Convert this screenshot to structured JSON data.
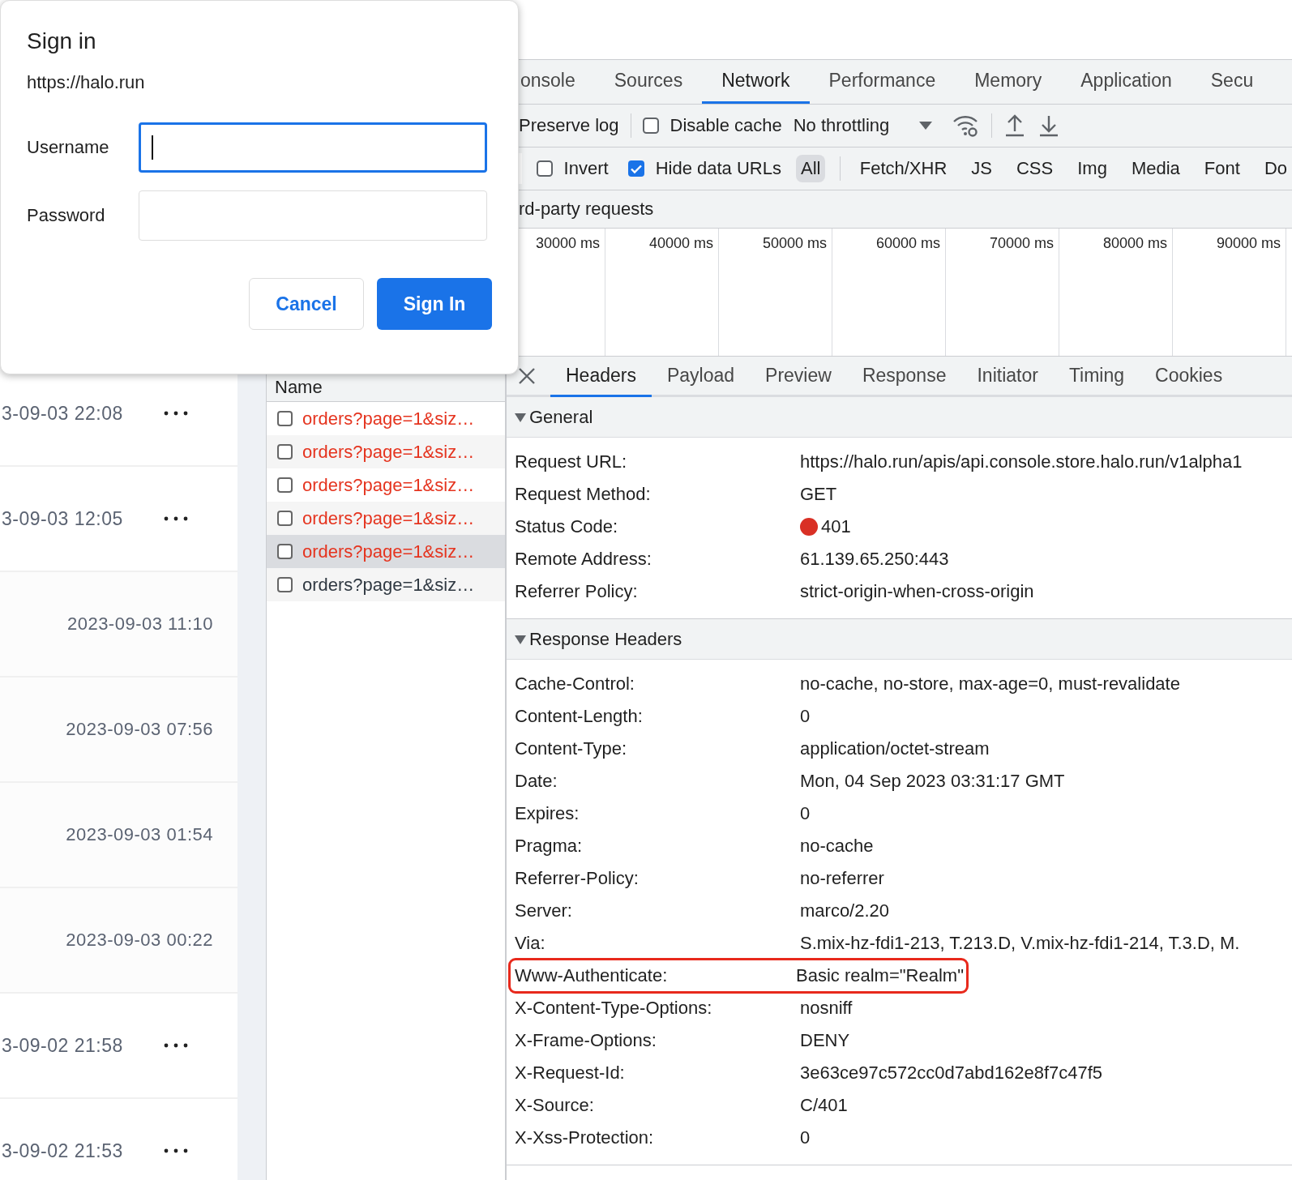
{
  "dialog": {
    "title": "Sign in",
    "origin": "https://halo.run",
    "fields": [
      {
        "label": "Username",
        "focused": true
      },
      {
        "label": "Password",
        "focused": false
      }
    ],
    "buttons": [
      {
        "label": "Cancel",
        "kind": "secondary"
      },
      {
        "label": "Sign In",
        "kind": "primary"
      }
    ]
  },
  "page_rows": [
    {
      "date": "3-09-03 22:08",
      "kind": "menu"
    },
    {
      "date": "3-09-03 12:05",
      "kind": "menu"
    },
    {
      "date": "2023-09-03 11:10",
      "kind": "plain"
    },
    {
      "date": "2023-09-03 07:56",
      "kind": "plain"
    },
    {
      "date": "2023-09-03 01:54",
      "kind": "plain"
    },
    {
      "date": "2023-09-03 00:22",
      "kind": "plain"
    },
    {
      "date": "3-09-02 21:58",
      "kind": "menu"
    },
    {
      "date": "3-09-02 21:53",
      "kind": "menu"
    }
  ],
  "devtools": {
    "tabs": [
      {
        "label": "onsole",
        "selected": false
      },
      {
        "label": "Sources",
        "selected": false
      },
      {
        "label": "Network",
        "selected": true
      },
      {
        "label": "Performance",
        "selected": false
      },
      {
        "label": "Memory",
        "selected": false
      },
      {
        "label": "Application",
        "selected": false
      },
      {
        "label": "Secu",
        "selected": false
      }
    ],
    "toolbar": {
      "preserve_log": "Preserve log",
      "disable_cache": {
        "label": "Disable cache",
        "checked": false
      },
      "throttling": "No throttling"
    },
    "filters": {
      "invert": {
        "label": "Invert",
        "checked": false
      },
      "hide_data_urls": {
        "label": "Hide data URLs",
        "checked": true
      },
      "types": [
        {
          "label": "All",
          "selected": true
        },
        {
          "label": "Fetch/XHR",
          "selected": false
        },
        {
          "label": "JS",
          "selected": false
        },
        {
          "label": "CSS",
          "selected": false
        },
        {
          "label": "Img",
          "selected": false
        },
        {
          "label": "Media",
          "selected": false
        },
        {
          "label": "Font",
          "selected": false
        },
        {
          "label": "Do",
          "selected": false
        }
      ]
    },
    "third_party": "rd-party requests",
    "timeline_ticks": [
      "30000 ms",
      "40000 ms",
      "50000 ms",
      "60000 ms",
      "70000 ms",
      "80000 ms",
      "90000 ms"
    ],
    "requests": {
      "column": "Name",
      "rows": [
        {
          "name": "orders?page=1&siz…",
          "error": true,
          "selected": false
        },
        {
          "name": "orders?page=1&siz…",
          "error": true,
          "selected": false
        },
        {
          "name": "orders?page=1&siz…",
          "error": true,
          "selected": false
        },
        {
          "name": "orders?page=1&siz…",
          "error": true,
          "selected": false
        },
        {
          "name": "orders?page=1&siz…",
          "error": true,
          "selected": true
        },
        {
          "name": "orders?page=1&siz…",
          "error": false,
          "selected": false
        }
      ]
    },
    "detail_tabs": [
      {
        "label": "Headers",
        "selected": true
      },
      {
        "label": "Payload",
        "selected": false
      },
      {
        "label": "Preview",
        "selected": false
      },
      {
        "label": "Response",
        "selected": false
      },
      {
        "label": "Initiator",
        "selected": false
      },
      {
        "label": "Timing",
        "selected": false
      },
      {
        "label": "Cookies",
        "selected": false
      }
    ],
    "sections": [
      {
        "title": "General",
        "expanded": true,
        "rows": [
          {
            "label": "Request URL:",
            "value": "https://halo.run/apis/api.console.store.halo.run/v1alpha1"
          },
          {
            "label": "Request Method:",
            "value": "GET"
          },
          {
            "label": "Status Code:",
            "value": "401",
            "color": "#d93025"
          },
          {
            "label": "Remote Address:",
            "value": "61.139.65.250:443"
          },
          {
            "label": "Referrer Policy:",
            "value": "strict-origin-when-cross-origin"
          }
        ]
      },
      {
        "title": "Response Headers",
        "expanded": true,
        "rows": [
          {
            "label": "Cache-Control:",
            "value": "no-cache, no-store, max-age=0, must-revalidate"
          },
          {
            "label": "Content-Length:",
            "value": "0"
          },
          {
            "label": "Content-Type:",
            "value": "application/octet-stream"
          },
          {
            "label": "Date:",
            "value": "Mon, 04 Sep 2023 03:31:17 GMT"
          },
          {
            "label": "Expires:",
            "value": "0"
          },
          {
            "label": "Pragma:",
            "value": "no-cache"
          },
          {
            "label": "Referrer-Policy:",
            "value": "no-referrer"
          },
          {
            "label": "Server:",
            "value": "marco/2.20"
          },
          {
            "label": "Via:",
            "value": "S.mix-hz-fdi1-213, T.213.D, V.mix-hz-fdi1-214, T.3.D, M."
          },
          {
            "label": "Www-Authenticate:",
            "value": "Basic realm=\"Realm\"",
            "highlighted": true
          },
          {
            "label": "X-Content-Type-Options:",
            "value": "nosniff"
          },
          {
            "label": "X-Frame-Options:",
            "value": "DENY"
          },
          {
            "label": "X-Request-Id:",
            "value": "3e63ce97c572cc0d7abd162e8f7c47f5"
          },
          {
            "label": "X-Source:",
            "value": "C/401"
          },
          {
            "label": "X-Xss-Protection:",
            "value": "0"
          }
        ]
      }
    ]
  }
}
